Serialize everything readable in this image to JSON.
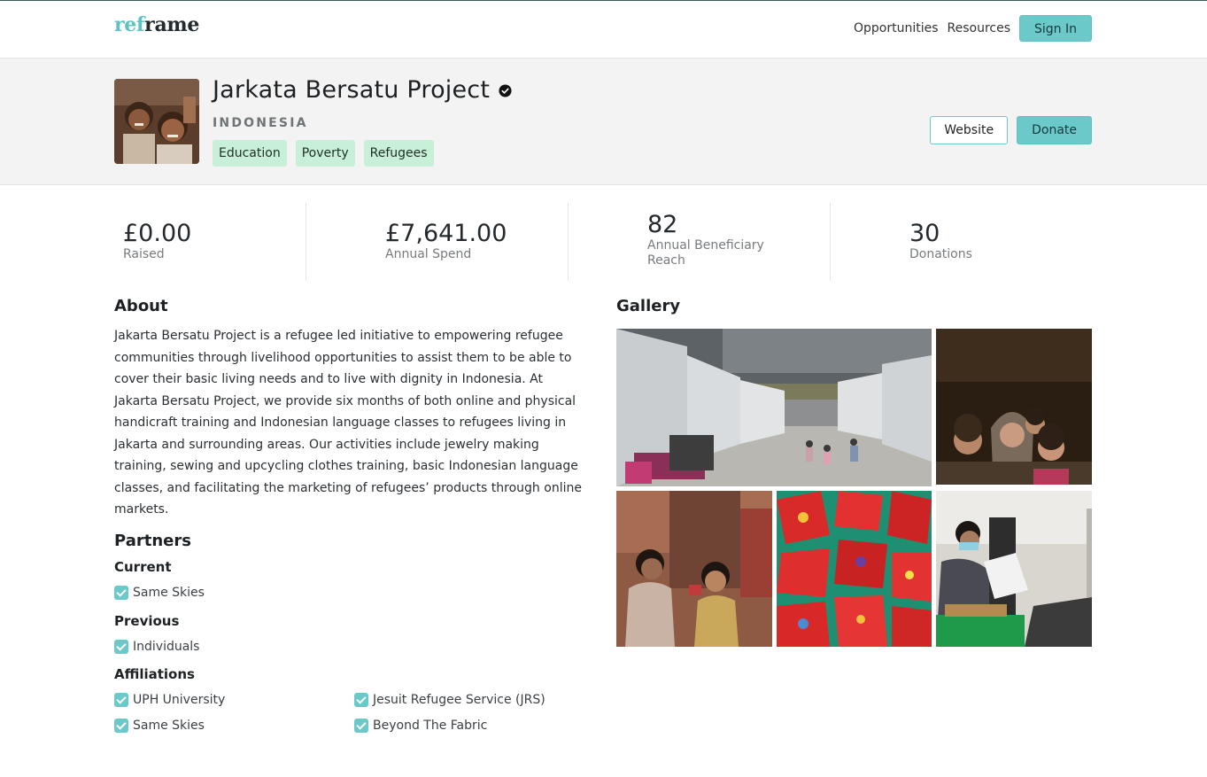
{
  "header": {
    "logo_part1": "ref",
    "logo_part2": "rame",
    "nav": [
      "Opportunities",
      "Resources"
    ],
    "sign_in": "Sign In"
  },
  "org": {
    "name": "Jarkata Bersatu Project",
    "country": "INDONESIA",
    "tags": [
      "Education",
      "Poverty",
      "Refugees"
    ],
    "website_label": "Website",
    "donate_label": "Donate",
    "verified": true
  },
  "stats": [
    {
      "value": "£0.00",
      "label": "Raised"
    },
    {
      "value": "£7,641.00",
      "label": "Annual Spend"
    },
    {
      "value": "82",
      "label": "Annual Beneficiary Reach"
    },
    {
      "value": "30",
      "label": "Donations"
    }
  ],
  "about": {
    "heading": "About",
    "text": "Jakarta Bersatu Project is a refugee led initiative to empowering refugee communities through livelihood opportunities to assist them to be able to cover their basic living needs and to live with dignity in Indonesia. At Jakarta Bersatu Project, we provide six months of both online and physical handicraft training and Indonesian language classes to refugees living in Jakarta and surrounding areas. Our activities include jewelry making training, sewing and upcycling clothes training, basic Indonesian language classes, and facilitating the marketing of refugees’ products through online markets."
  },
  "partners": {
    "heading": "Partners",
    "current_heading": "Current",
    "current": [
      "Same Skies"
    ],
    "previous_heading": "Previous",
    "previous": [
      "Individuals"
    ],
    "affiliations_heading": "Affiliations",
    "affiliations": [
      "UPH University",
      "Jesuit Refugee Service (JRS)",
      "Same Skies",
      "Beyond The Fabric"
    ]
  },
  "gallery": {
    "heading": "Gallery",
    "images": [
      "refugee-camp-photo",
      "family-portrait-photo",
      "women-talking-photo",
      "red-gift-bags-photo",
      "sewing-workshop-photo"
    ]
  },
  "colors": {
    "accent": "#6cc9c9",
    "tag_bg": "#c8f0d8",
    "band_bg": "#f3f3f3"
  }
}
